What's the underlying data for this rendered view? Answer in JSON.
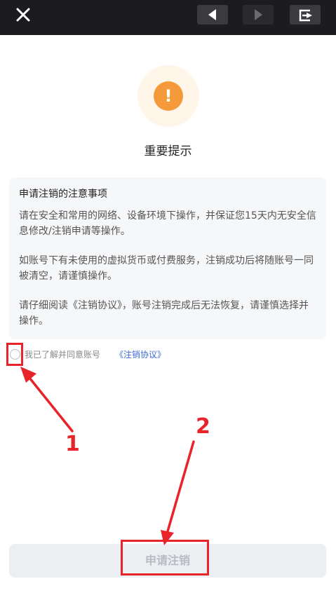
{
  "top_bar": {
    "close_icon": "close-x",
    "back_icon": "triangle-left",
    "forward_icon": "triangle-right",
    "refresh_icon": "refresh-box"
  },
  "dialog": {
    "icon": "exclamation",
    "icon_glyph": "!",
    "title": "重要提示"
  },
  "notice": {
    "heading": "申请注销的注意事项",
    "paragraphs": [
      "请在安全和常用的网络、设备环境下操作，并保证您15天内无安全信息修改/注销申请等操作。",
      "如账号下有未使用的虚拟货币或付费服务，注销成功后将随账号一同被清空，请谨慎操作。",
      "请仔细阅读《注销协议》，账号注销完成后无法恢复，请谨慎选择并操作。"
    ]
  },
  "agreement": {
    "checked": false,
    "text": "我已了解并同意账号",
    "link": "《注销协议》"
  },
  "submit": {
    "label": "申请注销",
    "enabled": false
  },
  "annotations": [
    {
      "label": "1"
    },
    {
      "label": "2"
    }
  ],
  "colors": {
    "top_bar_bg": "#1c1c20",
    "warning_orange": "#f59a3a",
    "link_blue": "#3e6bd6",
    "annotation_red": "#e8232a"
  }
}
